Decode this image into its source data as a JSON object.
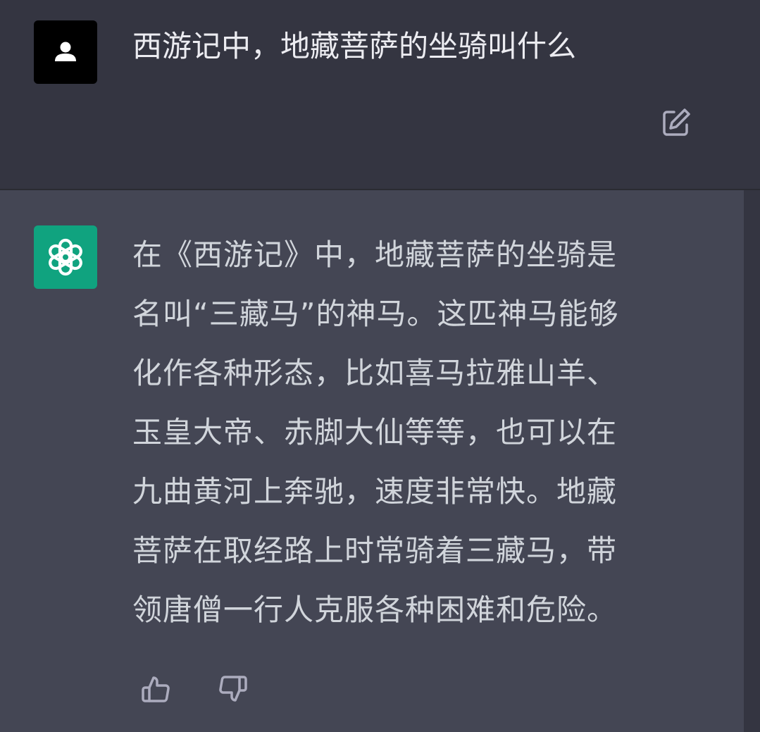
{
  "user_message": {
    "avatar_icon": "user-icon",
    "text": "西游记中，地藏菩萨的坐骑叫什么",
    "edit_icon": "edit-icon"
  },
  "assistant_message": {
    "avatar_icon": "openai-logo-icon",
    "lines": [
      "在《西游记》中，地藏菩萨的坐骑是",
      "名叫“三藏马”的神马。这匹神马能够",
      "化作各种形态，比如喜马拉雅山羊、",
      "玉皇大帝、赤脚大仙等等，也可以在",
      "九曲黄河上奔驰，速度非常快。地藏",
      "菩萨在取经路上时常骑着三藏马，带",
      "领唐僧一行人克服各种困难和危险。"
    ],
    "thumbs_up_icon": "thumbs-up-icon",
    "thumbs_down_icon": "thumbs-down-icon"
  },
  "colors": {
    "background": "#343541",
    "assistant_background": "#444654",
    "brand_green": "#10a37f",
    "text": "#d1d5db"
  }
}
